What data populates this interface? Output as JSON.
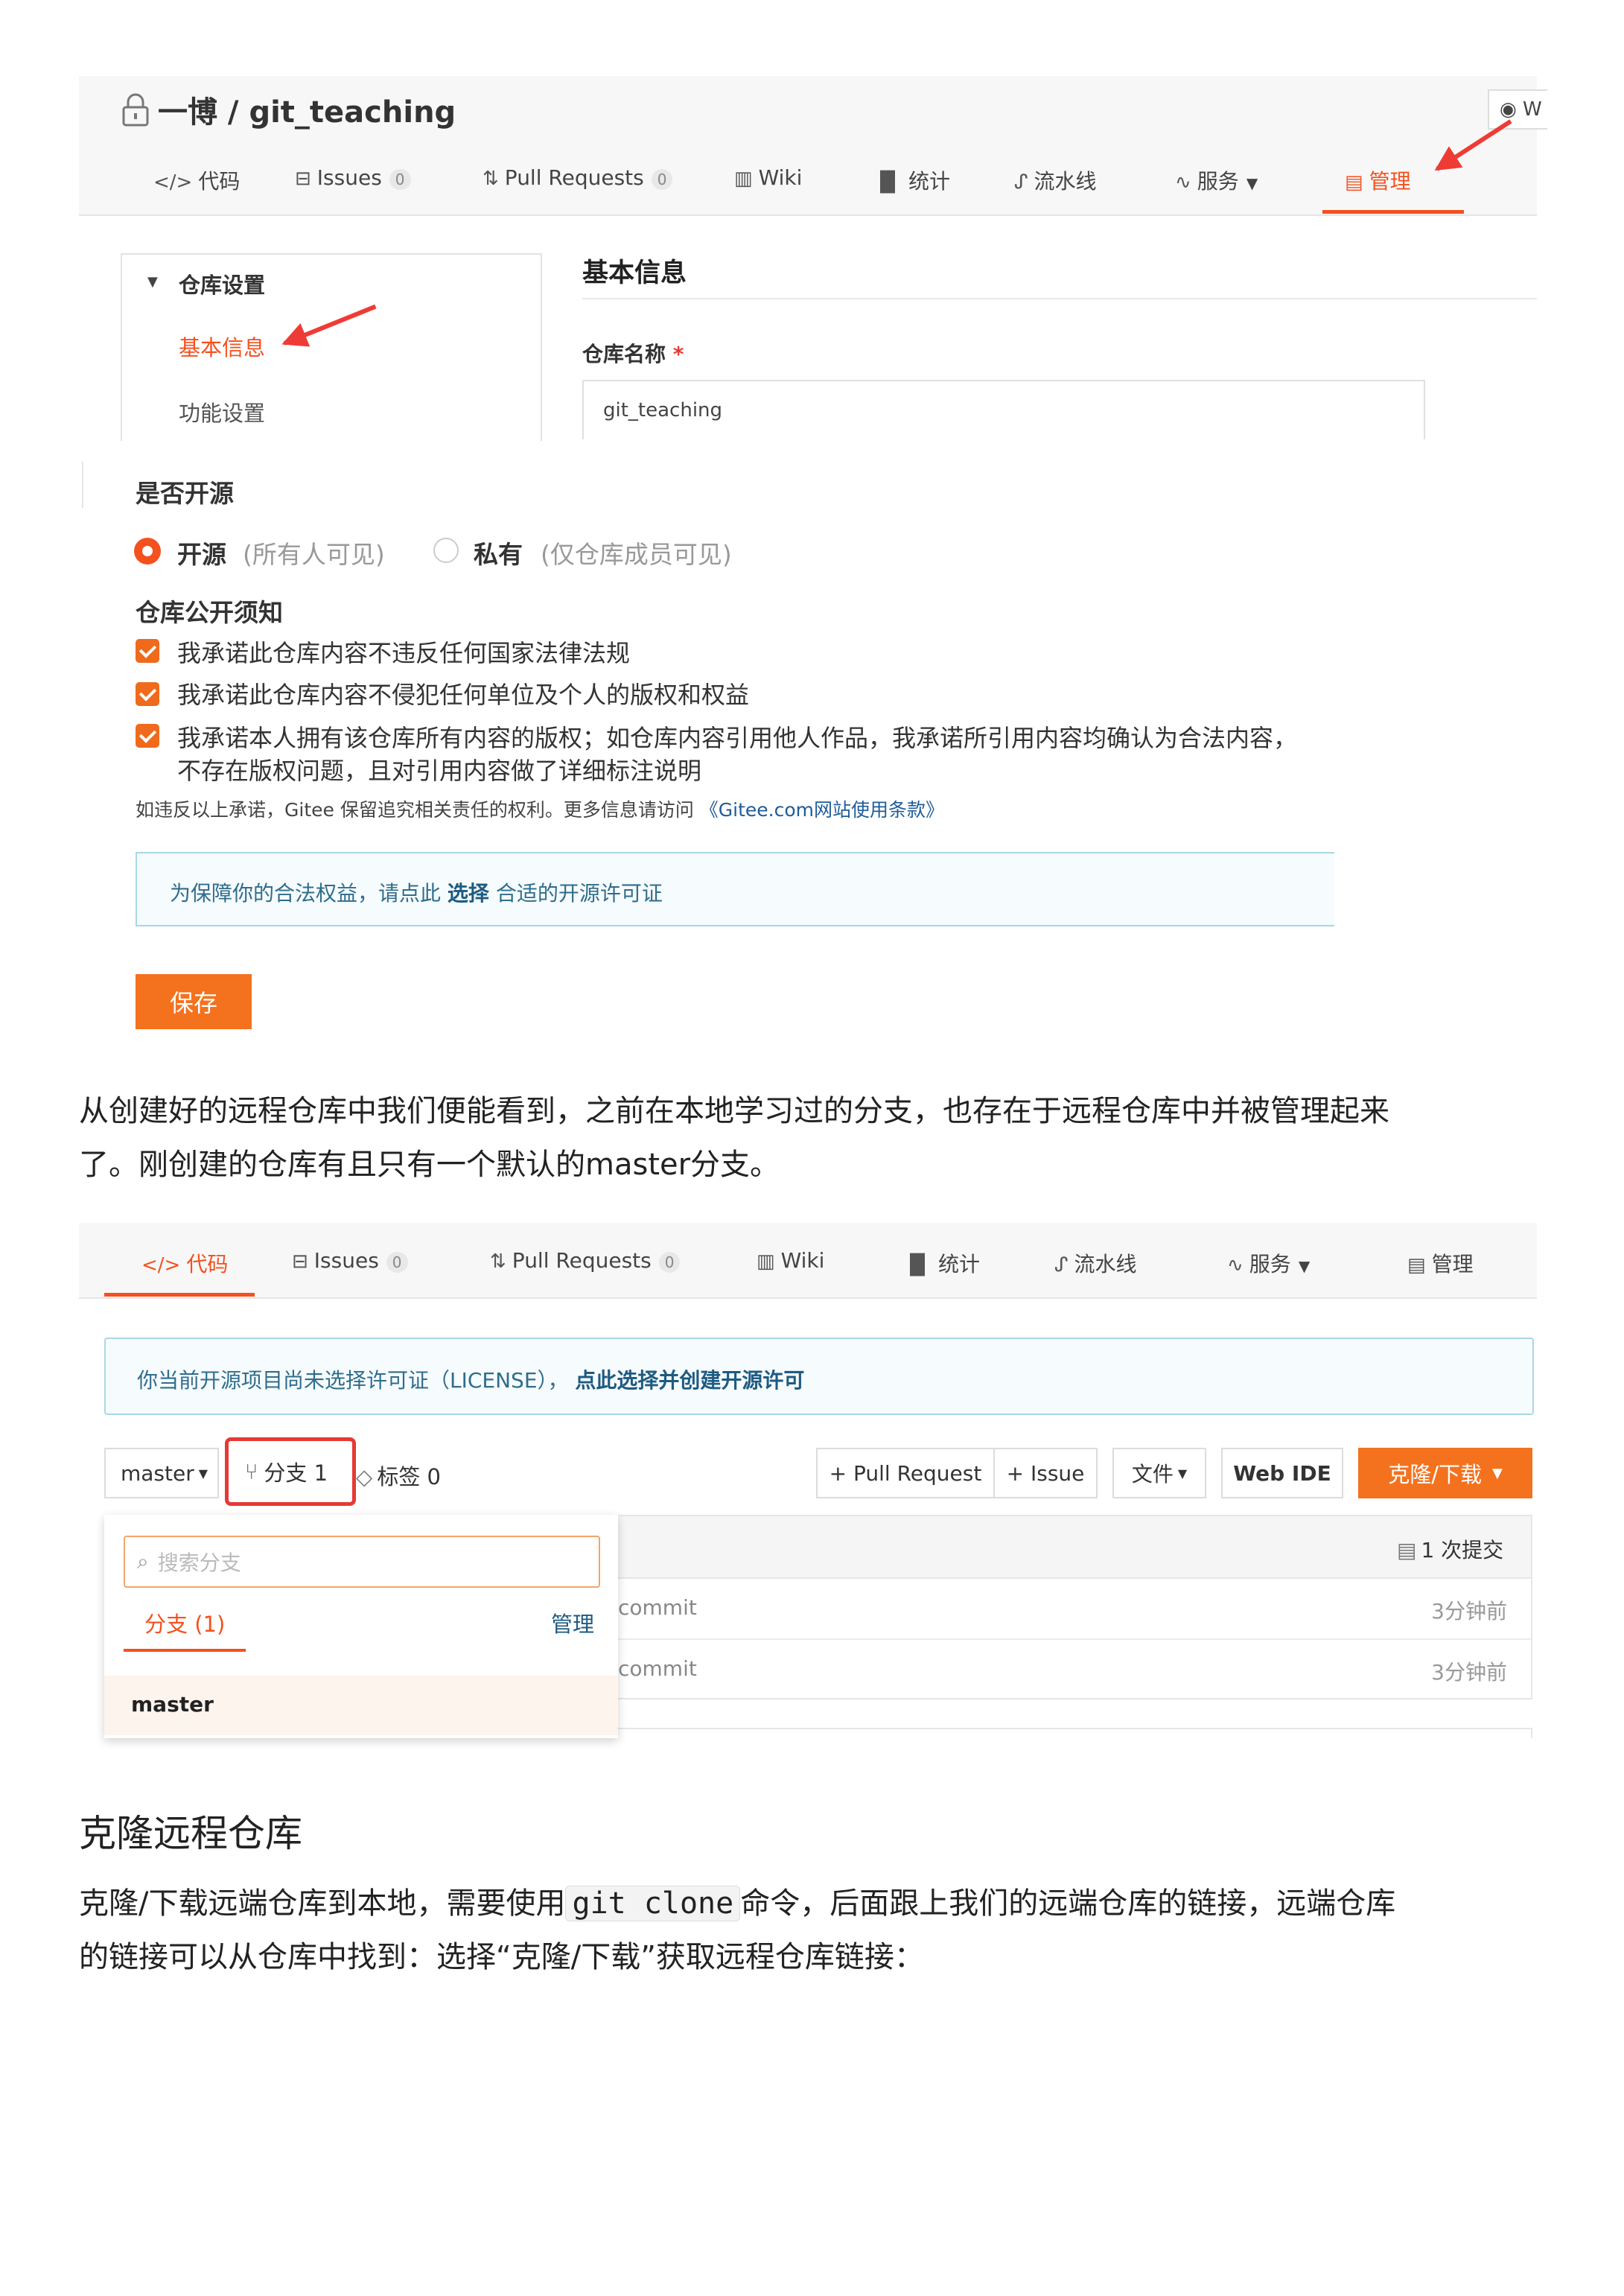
{
  "top_panel": {
    "repo_title": "一博 / git_teaching",
    "watch_label": "W",
    "tabs": [
      {
        "icon": "code-icon",
        "label": "代码"
      },
      {
        "icon": "issues-icon",
        "label": "Issues",
        "count": "0"
      },
      {
        "icon": "pull-request-icon",
        "label": "Pull Requests",
        "count": "0"
      },
      {
        "icon": "wiki-icon",
        "label": "Wiki"
      },
      {
        "icon": "chart-icon",
        "label": "统计"
      },
      {
        "icon": "pipeline-icon",
        "label": "流水线"
      },
      {
        "icon": "service-icon",
        "label": "服务"
      },
      {
        "icon": "manage-icon",
        "label": "管理"
      }
    ],
    "sidebar": {
      "group": "仓库设置",
      "items": [
        "基本信息",
        "功能设置"
      ]
    },
    "section_title": "基本信息",
    "repo_name_label": "仓库名称",
    "required_mark": "*",
    "repo_name_value": "git_teaching"
  },
  "open_source": {
    "label": "是否开源",
    "option_public": "开源",
    "option_public_note": "(所有人可见)",
    "option_private": "私有",
    "option_private_note": "(仅仓库成员可见)",
    "notice_title": "仓库公开须知",
    "checks": [
      "我承诺此仓库内容不违反任何国家法律法规",
      "我承诺此仓库内容不侵犯任何单位及个人的版权和权益",
      "我承诺本人拥有该仓库所有内容的版权；如仓库内容引用他人作品，我承诺所引用内容均确认为合法内容，",
      "不存在版权问题，且对引用内容做了详细标注说明"
    ],
    "warning_text": "如违反以上承诺，Gitee 保留追究相关责任的权利。更多信息请访问",
    "warning_link": "《Gitee.com网站使用条款》",
    "license_prefix": "为保障你的合法权益，请点此",
    "license_link": "选择",
    "license_suffix": "合适的开源许可证",
    "save_label": "保存"
  },
  "paragraph1": {
    "line1": "从创建好的远程仓库中我们便能看到，之前在本地学习过的分支，也存在于远程仓库中并被管理起来",
    "line2": "了。刚创建的仓库有且只有一个默认的master分支。"
  },
  "second_panel": {
    "tabs": [
      {
        "icon": "code-icon",
        "label": "代码"
      },
      {
        "icon": "issues-icon",
        "label": "Issues",
        "count": "0"
      },
      {
        "icon": "pull-request-icon",
        "label": "Pull Requests",
        "count": "0"
      },
      {
        "icon": "wiki-icon",
        "label": "Wiki"
      },
      {
        "icon": "chart-icon",
        "label": "统计"
      },
      {
        "icon": "pipeline-icon",
        "label": "流水线"
      },
      {
        "icon": "service-icon",
        "label": "服务"
      },
      {
        "icon": "manage-icon",
        "label": "管理"
      }
    ],
    "license_notice": "你当前开源项目尚未选择许可证（LICENSE），",
    "license_action": "点此选择并创建开源许可",
    "branch_select": "master",
    "branches_label": "分支 1",
    "tags_label": "标签 0",
    "pull_request_btn": "+ Pull Request",
    "issue_btn": "+ Issue",
    "file_btn": "文件",
    "web_ide_btn": "Web IDE",
    "clone_btn": "克隆/下载",
    "commits_label": "1 次提交",
    "rows": [
      {
        "message": "commit",
        "time": "3分钟前"
      },
      {
        "message": "commit",
        "time": "3分钟前"
      }
    ],
    "dropdown": {
      "search_placeholder": "搜索分支",
      "tab_label": "分支 (1)",
      "manage_label": "管理",
      "branch_item": "master"
    }
  },
  "section_heading": "克隆远程仓库",
  "paragraph2": {
    "part1": "克隆/下载远端仓库到本地，需要使用",
    "code": "git clone",
    "part2": "命令，后面跟上我们的远端仓库的链接，远端仓库",
    "line2": "的链接可以从仓库中找到：选择“克隆/下载”获取远程仓库链接："
  }
}
